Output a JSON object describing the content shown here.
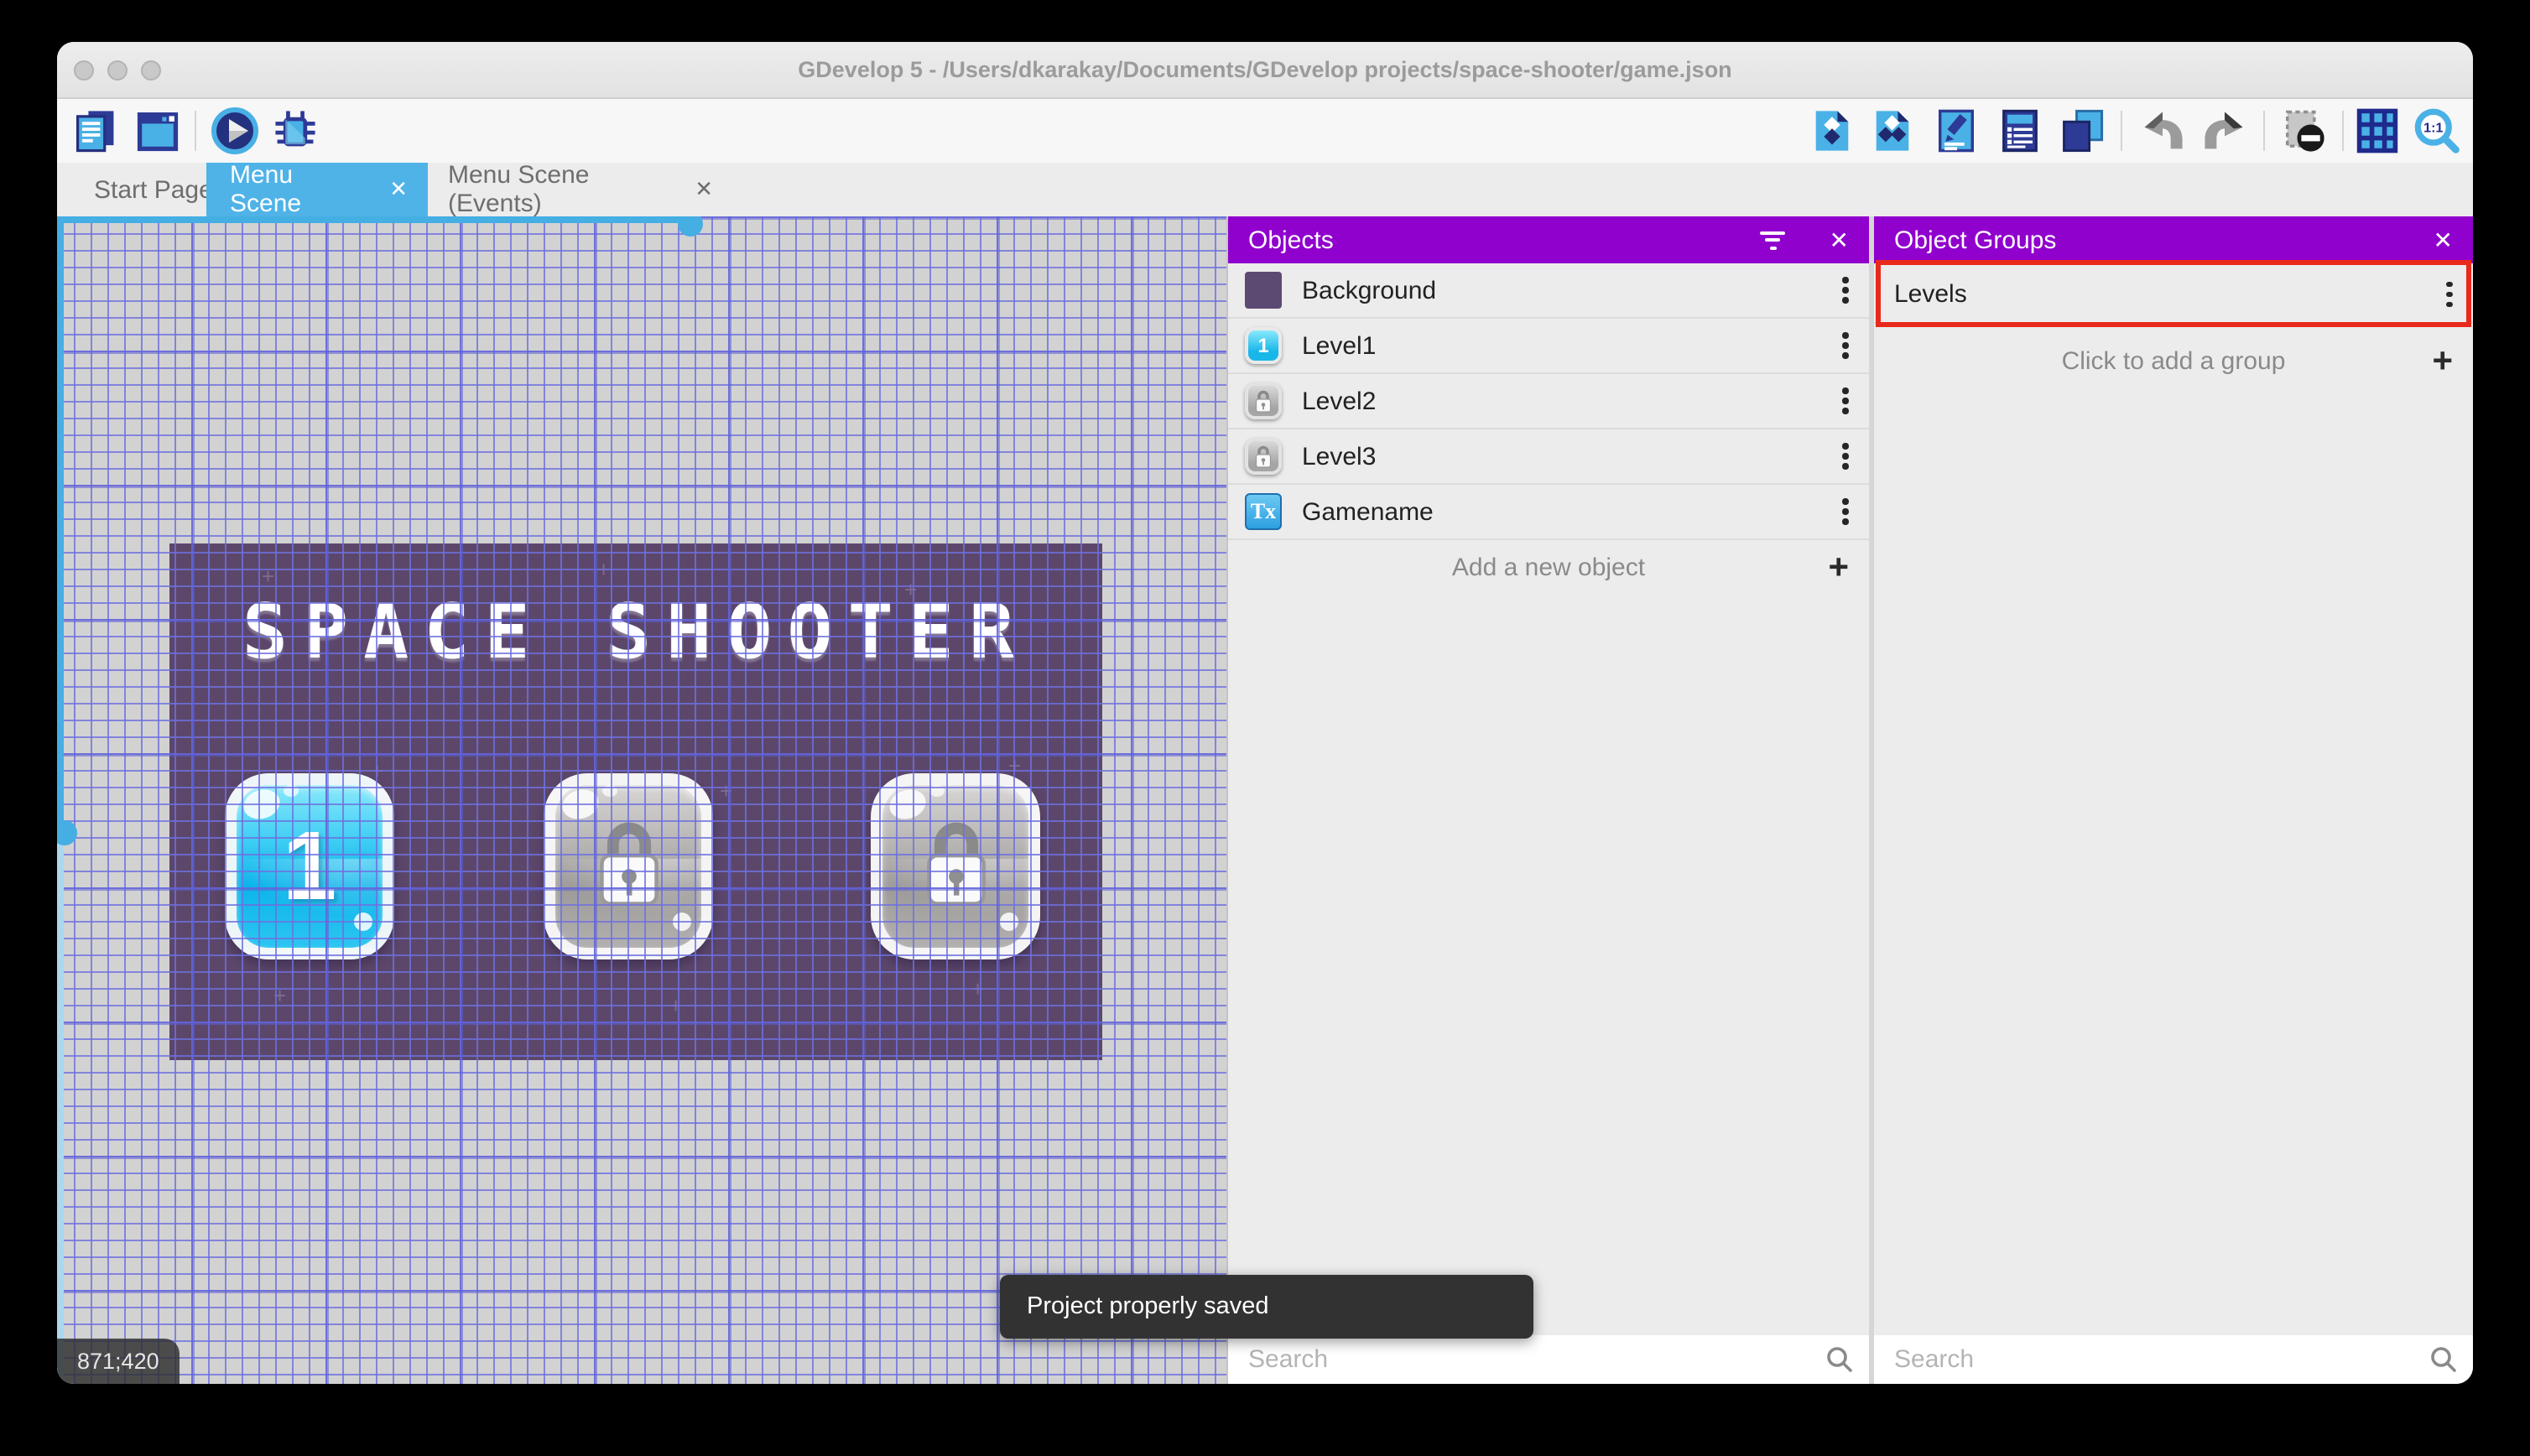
{
  "window": {
    "title": "GDevelop 5 - /Users/dkarakay/Documents/GDevelop projects/space-shooter/game.json",
    "traffic_lights": [
      "close",
      "minimize",
      "zoom"
    ]
  },
  "toolbar": {
    "left_icons": [
      "project-manager-icon",
      "scene-editor-icon",
      "play-icon",
      "debug-icon"
    ],
    "right_icons": [
      "objects-panel-icon",
      "object-groups-panel-icon",
      "properties-icon",
      "instances-list-icon",
      "layers-icon",
      "undo-icon",
      "redo-icon",
      "toggle-mask-icon",
      "grid-icon",
      "zoom-fit-icon"
    ],
    "zoom_label": "1:1"
  },
  "tabs": [
    {
      "label": "Start Page",
      "active": false,
      "closable": false
    },
    {
      "label": "Menu Scene",
      "active": true,
      "closable": true
    },
    {
      "label": "Menu Scene (Events)",
      "active": false,
      "closable": true
    }
  ],
  "canvas": {
    "coordinates": "871;420",
    "scene": {
      "title": "SPACE SHOOTER",
      "buttons": [
        {
          "label": "1",
          "state": "unlocked"
        },
        {
          "label": "",
          "state": "locked"
        },
        {
          "label": "",
          "state": "locked"
        }
      ]
    }
  },
  "panels": {
    "objects": {
      "title": "Objects",
      "rows": [
        {
          "label": "Background",
          "thumb": "background-swatch"
        },
        {
          "label": "Level1",
          "thumb": "level1-button",
          "thumb_label": "1"
        },
        {
          "label": "Level2",
          "thumb": "locked-button"
        },
        {
          "label": "Level3",
          "thumb": "locked-button"
        },
        {
          "label": "Gamename",
          "thumb": "text-object",
          "thumb_label": "Tx"
        }
      ],
      "add_label": "Add a new object",
      "search_placeholder": "Search"
    },
    "object_groups": {
      "title": "Object Groups",
      "rows": [
        {
          "label": "Levels",
          "highlighted": true
        }
      ],
      "add_label": "Click to add a group",
      "search_placeholder": "Search"
    }
  },
  "toast": {
    "message": "Project properly saved"
  },
  "icons": {
    "close": "✕",
    "plus": "+"
  },
  "colors": {
    "accent_purple": "#9001cd",
    "tab_blue": "#4fb3e8",
    "scrollbar_blue": "#45aee3",
    "annotation_red": "#e8291c",
    "scene_purple": "#5c476b",
    "grid_line": "#6e70e0",
    "toast_bg": "#323232"
  }
}
